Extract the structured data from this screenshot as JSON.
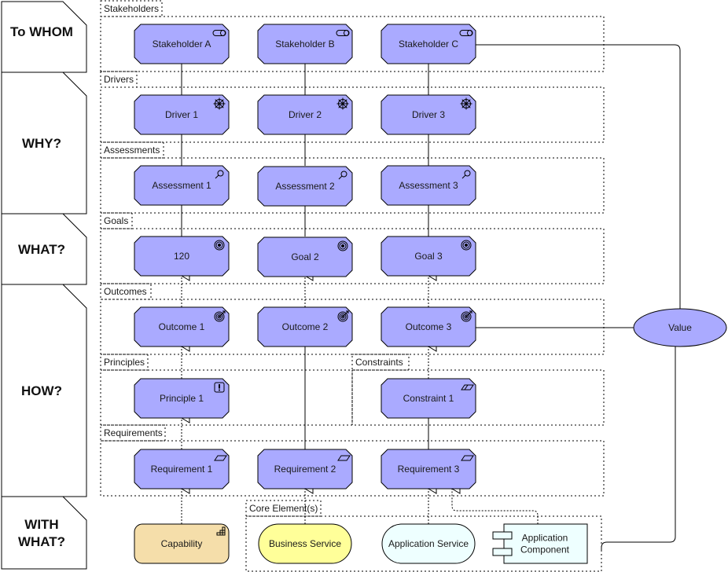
{
  "diagram": {
    "rows": [
      {
        "id": "to-whom",
        "label": [
          "To WHOM"
        ]
      },
      {
        "id": "why",
        "label": [
          "WHY?"
        ]
      },
      {
        "id": "what",
        "label": [
          "WHAT?"
        ]
      },
      {
        "id": "how",
        "label": [
          "HOW?"
        ]
      },
      {
        "id": "with-what",
        "label": [
          "WITH",
          "WHAT?"
        ]
      }
    ],
    "groups": [
      {
        "id": "stakeholders",
        "label": "Stakeholders"
      },
      {
        "id": "drivers",
        "label": "Drivers"
      },
      {
        "id": "assessments",
        "label": "Assessments"
      },
      {
        "id": "goals",
        "label": "Goals"
      },
      {
        "id": "outcomes",
        "label": "Outcomes"
      },
      {
        "id": "principles",
        "label": "Principles"
      },
      {
        "id": "constraints",
        "label": "Constraints"
      },
      {
        "id": "requirements",
        "label": "Requirements"
      },
      {
        "id": "core-elements",
        "label": "Core Element(s)"
      }
    ],
    "elements": [
      {
        "id": "stakeholder-a",
        "label": "Stakeholder A",
        "type": "stakeholder",
        "icon": "stakeholder-icon"
      },
      {
        "id": "stakeholder-b",
        "label": "Stakeholder B",
        "type": "stakeholder",
        "icon": "stakeholder-icon"
      },
      {
        "id": "stakeholder-c",
        "label": "Stakeholder C",
        "type": "stakeholder",
        "icon": "stakeholder-icon"
      },
      {
        "id": "driver-1",
        "label": "Driver 1",
        "type": "driver",
        "icon": "driver-wheel-icon"
      },
      {
        "id": "driver-2",
        "label": "Driver 2",
        "type": "driver",
        "icon": "driver-wheel-icon"
      },
      {
        "id": "driver-3",
        "label": "Driver 3",
        "type": "driver",
        "icon": "driver-wheel-icon"
      },
      {
        "id": "assessment-1",
        "label": "Assessment 1",
        "type": "assessment",
        "icon": "magnifier-icon"
      },
      {
        "id": "assessment-2",
        "label": "Assessment 2",
        "type": "assessment",
        "icon": "magnifier-icon"
      },
      {
        "id": "assessment-3",
        "label": "Assessment 3",
        "type": "assessment",
        "icon": "magnifier-icon"
      },
      {
        "id": "goal-1",
        "label": "120",
        "type": "goal",
        "icon": "target-icon"
      },
      {
        "id": "goal-2",
        "label": "Goal 2",
        "type": "goal",
        "icon": "target-icon"
      },
      {
        "id": "goal-3",
        "label": "Goal 3",
        "type": "goal",
        "icon": "target-icon"
      },
      {
        "id": "outcome-1",
        "label": "Outcome 1",
        "type": "outcome",
        "icon": "target-arrow-icon"
      },
      {
        "id": "outcome-2",
        "label": "Outcome 2",
        "type": "outcome",
        "icon": "target-arrow-icon"
      },
      {
        "id": "outcome-3",
        "label": "Outcome 3",
        "type": "outcome",
        "icon": "target-arrow-icon"
      },
      {
        "id": "principle-1",
        "label": "Principle 1",
        "type": "principle",
        "icon": "exclamation-icon"
      },
      {
        "id": "constraint-1",
        "label": "Constraint 1",
        "type": "constraint",
        "icon": "parallelogram-double-icon"
      },
      {
        "id": "requirement-1",
        "label": "Requirement 1",
        "type": "requirement",
        "icon": "parallelogram-icon"
      },
      {
        "id": "requirement-2",
        "label": "Requirement 2",
        "type": "requirement",
        "icon": "parallelogram-icon"
      },
      {
        "id": "requirement-3",
        "label": "Requirement 3",
        "type": "requirement",
        "icon": "parallelogram-icon"
      },
      {
        "id": "capability",
        "label": "Capability",
        "type": "capability",
        "icon": "capability-steps-icon"
      },
      {
        "id": "business-service",
        "label": "Business Service",
        "type": "business-service"
      },
      {
        "id": "application-service",
        "label": "Application Service",
        "type": "application-service"
      },
      {
        "id": "application-component",
        "label": [
          "Application",
          "Component"
        ],
        "type": "application-component",
        "icon": "component-icon"
      },
      {
        "id": "value",
        "label": "Value",
        "type": "value"
      }
    ],
    "colors": {
      "motivation": "#aaaaff",
      "capability": "#f5deaa",
      "business": "#ffff99",
      "application": "#eeffff",
      "stroke": "#000000"
    }
  }
}
